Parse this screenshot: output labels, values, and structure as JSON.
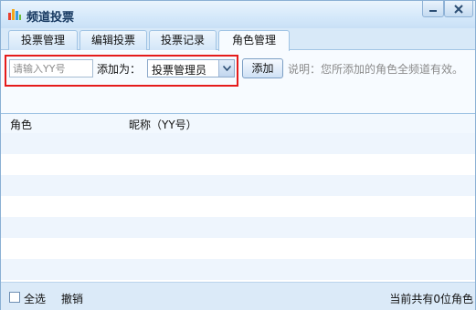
{
  "window": {
    "title": "频道投票",
    "icon": "bar-chart-icon",
    "minimize_icon": "minimize-icon",
    "close_icon": "close-icon"
  },
  "tabs": [
    {
      "label": "投票管理",
      "active": false
    },
    {
      "label": "编辑投票",
      "active": false
    },
    {
      "label": "投票记录",
      "active": false
    },
    {
      "label": "角色管理",
      "active": true
    }
  ],
  "add_role": {
    "yy_placeholder": "请输入YY号",
    "yy_value": "",
    "add_as_label": "添加为：",
    "role_selected": "投票管理员",
    "add_button": "添加",
    "note": "说明：您所添加的角色全频道有效。"
  },
  "table": {
    "columns": [
      "角色",
      "昵称（YY号）"
    ],
    "rows": []
  },
  "footer": {
    "select_all": "全选",
    "revoke": "撤销",
    "count_text": "当前共有0位角色"
  },
  "colors": {
    "highlight_border": "#e51b1b",
    "title_text": "#15375f",
    "row_stripe": "#eef5fd"
  }
}
